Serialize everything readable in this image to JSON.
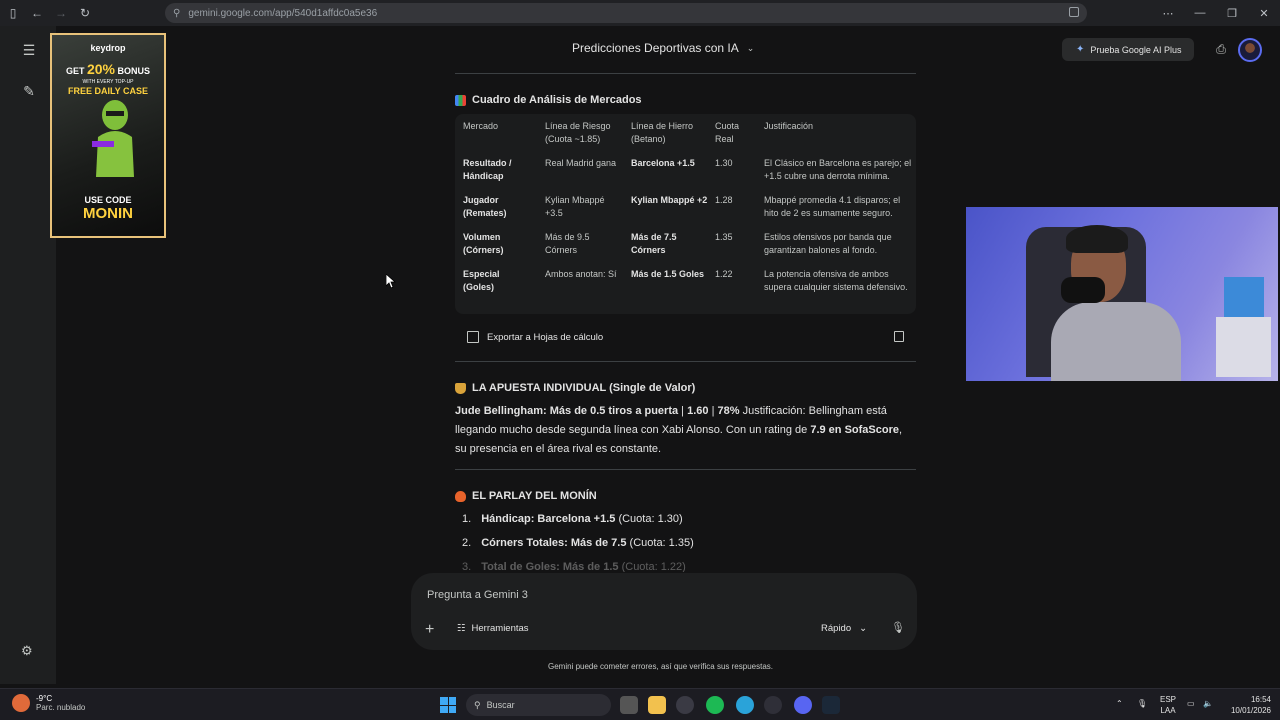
{
  "browser": {
    "url": "gemini.google.com/app/540d1affdc0a5e36"
  },
  "ad": {
    "brand": "keydrop",
    "line1_prefix": "GET",
    "line1_value": "20%",
    "line1_suffix": "BONUS",
    "line2": "WITH EVERY TOP-UP",
    "line3": "FREE DAILY CASE",
    "use": "USE CODE",
    "code": "MONIN"
  },
  "header": {
    "title": "Predicciones Deportivas con IA",
    "plus_button": "Prueba Google AI Plus"
  },
  "analysis": {
    "heading": "Cuadro de Análisis de Mercados",
    "columns": [
      "Mercado",
      "Línea de Riesgo (Cuota ~1.85)",
      "Línea de Hierro (Betano)",
      "Cuota Real",
      "Justificación"
    ],
    "rows": [
      {
        "market": "Resultado / Hándicap",
        "risk": "Real Madrid gana",
        "iron": "Barcelona +1.5",
        "odds": "1.30",
        "just": "El Clásico en Barcelona es parejo; el +1.5 cubre una derrota mínima."
      },
      {
        "market": "Jugador (Remates)",
        "risk": "Kylian Mbappé +3.5",
        "iron": "Kylian Mbappé +2",
        "odds": "1.28",
        "just": "Mbappé promedia 4.1 disparos; el hito de 2 es sumamente seguro."
      },
      {
        "market": "Volumen (Córners)",
        "risk": "Más de 9.5 Córners",
        "iron": "Más de 7.5 Córners",
        "odds": "1.35",
        "just": "Estilos ofensivos por banda que garantizan balones al fondo."
      },
      {
        "market": "Especial (Goles)",
        "risk": "Ambos anotan: Sí",
        "iron": "Más de 1.5 Goles",
        "odds": "1.22",
        "just": "La potencia ofensiva de ambos supera cualquier sistema defensivo."
      }
    ],
    "export_label": "Exportar a Hojas de cálculo"
  },
  "single": {
    "heading": "LA APUESTA INDIVIDUAL (Single de Valor)",
    "bold1": "Jude Bellingham: Más de 0.5 tiros a puerta",
    "sep1": " | ",
    "odds": "1.60",
    "sep2": " | ",
    "pct": "78%",
    "text1": " Justificación: Bellingham está llegando mucho desde segunda línea con Xabi Alonso. Con un rating de ",
    "bold2": "7.9 en SofaScore",
    "text2": ", su presencia en el área rival es constante."
  },
  "parlay": {
    "heading": "EL PARLAY DEL MONÍN",
    "items": [
      {
        "num": "1.",
        "bold": "Hándicap: Barcelona +1.5",
        "rest": " (Cuota: 1.30)"
      },
      {
        "num": "2.",
        "bold": "Córners Totales: Más de 7.5",
        "rest": " (Cuota: 1.35)"
      },
      {
        "num": "3.",
        "bold": "Total de Goles: Más de 1.5",
        "rest": " (Cuota: 1.22)"
      }
    ]
  },
  "prompt": {
    "placeholder": "Pregunta a Gemini 3",
    "tools": "Herramientas",
    "mode": "Rápido",
    "disclaimer": "Gemini puede cometer errores, así que verifica sus respuestas."
  },
  "taskbar": {
    "temp": "-9°C",
    "weather": "Parc. nublado",
    "search": "Buscar",
    "lang1": "ESP",
    "lang2": "LAA",
    "time": "16:54",
    "date": "10/01/2026"
  }
}
